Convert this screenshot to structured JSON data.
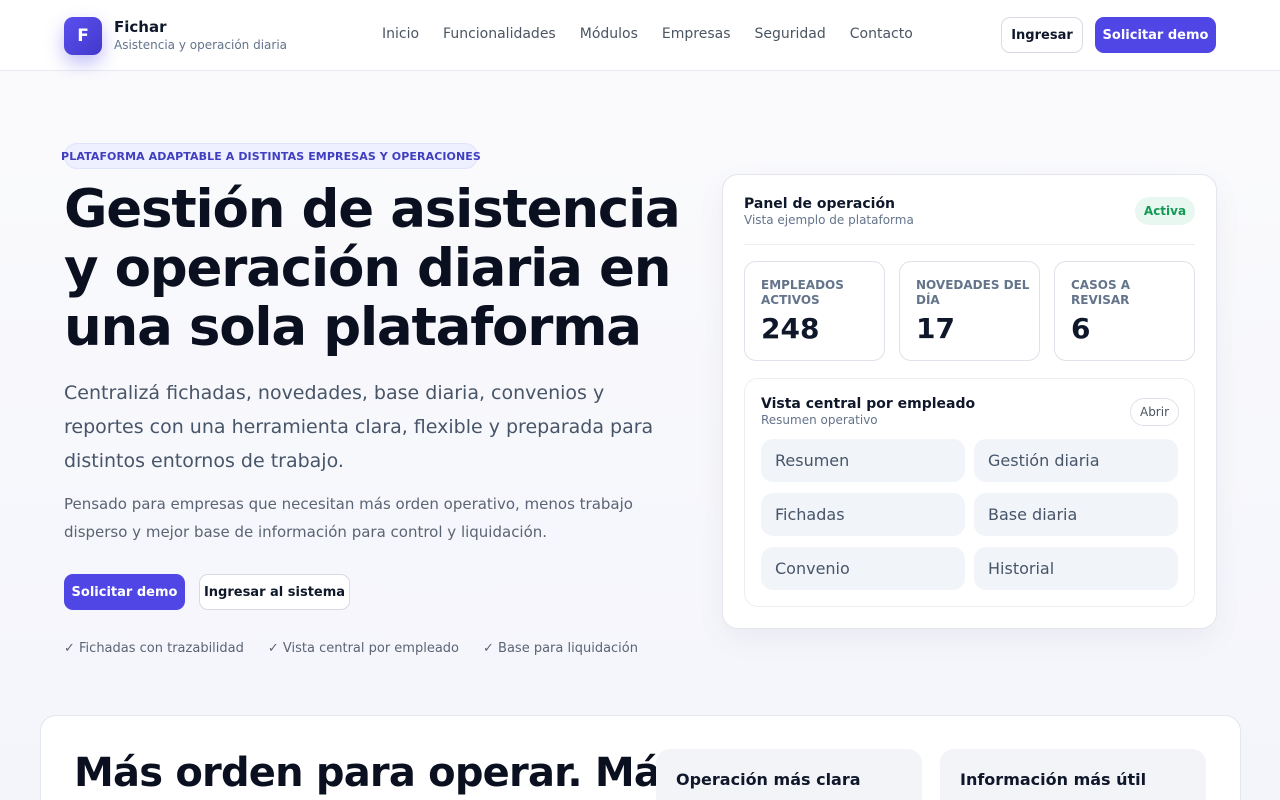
{
  "header": {
    "logo_letter": "F",
    "brand_name": "Fichar",
    "brand_sub": "Asistencia y operación diaria",
    "nav": [
      "Inicio",
      "Funcionalidades",
      "Módulos",
      "Empresas",
      "Seguridad",
      "Contacto"
    ],
    "login_label": "Ingresar",
    "demo_label": "Solicitar demo"
  },
  "hero": {
    "tag": "PLATAFORMA ADAPTABLE A DISTINTAS EMPRESAS Y OPERACIONES",
    "title": "Gestión de asistencia y operación diaria en una sola plataforma",
    "lead": "Centralizá fichadas, novedades, base diaria, convenios y reportes con una herramienta clara, flexible y preparada para distintos entornos de trabajo.",
    "sub": "Pensado para empresas que necesitan más orden operativo, menos trabajo disperso y mejor base de información para control y liquidación.",
    "cta_primary": "Solicitar demo",
    "cta_secondary": "Ingresar al sistema",
    "checks": [
      "✓ Fichadas con trazabilidad",
      "✓ Vista central por empleado",
      "✓ Base para liquidación"
    ]
  },
  "panel": {
    "title": "Panel de operación",
    "subtitle": "Vista ejemplo de plataforma",
    "status": "Activa",
    "stats": [
      {
        "label": "Empleados activos",
        "value": "248"
      },
      {
        "label": "Novedades del día",
        "value": "17"
      },
      {
        "label": "Casos a revisar",
        "value": "6"
      }
    ],
    "employee_view": {
      "title": "Vista central por empleado",
      "subtitle": "Resumen operativo",
      "open_label": "Abrir",
      "modules": [
        "Resumen",
        "Gestión diaria",
        "Fichadas",
        "Base diaria",
        "Convenio",
        "Historial"
      ]
    }
  },
  "section": {
    "title": "Más orden para operar. Más",
    "features": [
      "Operación más clara",
      "Información más útil"
    ]
  },
  "colors": {
    "accent": "#4f46e5",
    "success": "#129a55",
    "text": "#0f172a",
    "muted": "#64748b"
  }
}
